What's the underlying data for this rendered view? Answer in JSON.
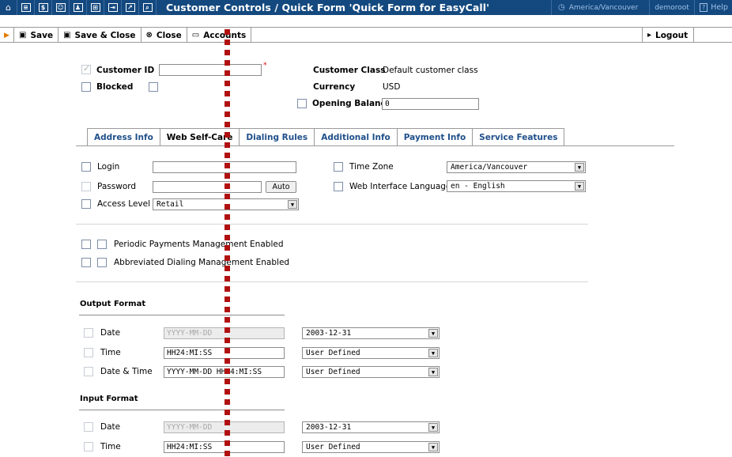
{
  "topbar": {
    "title": "Customer Controls / Quick Form 'Quick Form for EasyCall'",
    "timezone": "America/Vancouver",
    "user": "demoroot",
    "help": "Help"
  },
  "toolbar": {
    "save": "Save",
    "save_close": "Save & Close",
    "close": "Close",
    "accounts": "Accounts",
    "logout": "Logout"
  },
  "customer": {
    "id_label": "Customer ID",
    "id_value": "",
    "blocked_label": "Blocked",
    "class_label": "Customer Class",
    "class_value": "Default customer class",
    "currency_label": "Currency",
    "currency_value": "USD",
    "opening_balance_label": "Opening Balance",
    "opening_balance_value": "0"
  },
  "tabs": [
    "Address Info",
    "Web Self-Care",
    "Dialing Rules",
    "Additional Info",
    "Payment Info",
    "Service Features"
  ],
  "selfcare": {
    "login_label": "Login",
    "login_value": "",
    "password_label": "Password",
    "password_value": "",
    "auto_button": "Auto",
    "access_label": "Access Level",
    "access_value": "Retail",
    "timezone_label": "Time Zone",
    "timezone_value": "America/Vancouver",
    "language_label": "Web Interface Language",
    "language_value": "en - English",
    "periodic_label": "Periodic Payments Management Enabled",
    "abbrev_label": "Abbreviated Dialing Management Enabled"
  },
  "output_format": {
    "heading": "Output Format",
    "date_label": "Date",
    "date_value": "YYYY-MM-DD",
    "date_select": "2003-12-31",
    "time_label": "Time",
    "time_value": "HH24:MI:SS",
    "time_select": "User Defined",
    "datetime_label": "Date & Time",
    "datetime_value": "YYYY-MM-DD HH24:MI:SS",
    "datetime_select": "User Defined"
  },
  "input_format": {
    "heading": "Input Format",
    "date_label": "Date",
    "date_value": "YYYY-MM-DD",
    "date_select": "2003-12-31",
    "time_label": "Time",
    "time_value": "HH24:MI:SS",
    "time_select": "User Defined"
  }
}
